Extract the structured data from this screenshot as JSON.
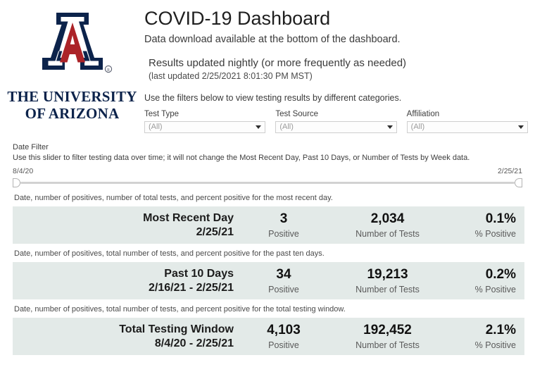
{
  "logo": {
    "mark_name": "block-a-logo",
    "wordmark_line1": "THE UNIVERSITY",
    "wordmark_line2": "OF ARIZONA",
    "navy": "#0c234b",
    "red": "#ab2328"
  },
  "header": {
    "title": "COVID-19 Dashboard",
    "subtitle": "Data download available at the bottom of the dashboard.",
    "results_line": "Results updated nightly (or more frequently as needed)",
    "updated_line": "(last updated 2/25/2021 8:01:30 PM MST)",
    "filters_hint": "Use the filters below to view testing results by different categories."
  },
  "filters": [
    {
      "label": "Test Type",
      "value": "(All)"
    },
    {
      "label": "Test Source",
      "value": "(All)"
    },
    {
      "label": "Affiliation",
      "value": "(All)"
    }
  ],
  "date_filter": {
    "title": "Date Filter",
    "description": "Use this slider to filter testing data over time; it will not change the Most Recent Day, Past 10 Days, or Number of Tests by Week data.",
    "start": "8/4/20",
    "end": "2/25/21"
  },
  "sections": [
    {
      "caption": "Date, number of positives, number of total tests, and percent positive for the most recent day.",
      "title": "Most Recent Day",
      "range": "2/25/21",
      "positive_value": "3",
      "positive_label": "Positive",
      "tests_value": "2,034",
      "tests_label": "Number of Tests",
      "pct_value": "0.1%",
      "pct_label": "% Positive"
    },
    {
      "caption": "Date, number of positives, total number of tests, and percent positive for the past ten days.",
      "title": "Past 10 Days",
      "range": "2/16/21 - 2/25/21",
      "positive_value": "34",
      "positive_label": "Positive",
      "tests_value": "19,213",
      "tests_label": "Number of Tests",
      "pct_value": "0.2%",
      "pct_label": "% Positive"
    },
    {
      "caption": "Date, number of positives, total number of tests, and percent positive for the total testing window.",
      "title": "Total Testing Window",
      "range": "8/4/20 - 2/25/21",
      "positive_value": "4,103",
      "positive_label": "Positive",
      "tests_value": "192,452",
      "tests_label": "Number of Tests",
      "pct_value": "2.1%",
      "pct_label": "% Positive"
    }
  ],
  "colors": {
    "band_background": "#e3eae8",
    "text_dark": "#1c1c1c",
    "text_muted": "#5a5a5a"
  }
}
